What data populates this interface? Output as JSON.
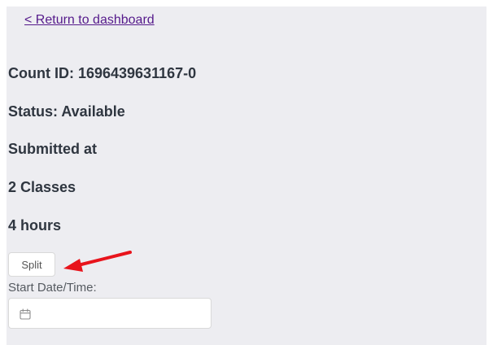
{
  "nav": {
    "back_label": "< Return to dashboard"
  },
  "details": {
    "count_id": "Count ID: 1696439631167-0",
    "status": "Status: Available",
    "submitted": "Submitted at",
    "classes": "2 Classes",
    "hours": "4 hours"
  },
  "actions": {
    "split_label": "Split"
  },
  "start_datetime": {
    "label": "Start Date/Time:",
    "value": "",
    "icon": "calendar-icon"
  },
  "colors": {
    "page_background": "#ededf1",
    "link": "#551a8b",
    "heading_text": "#2f3640",
    "annotation_arrow": "#e8141c"
  }
}
